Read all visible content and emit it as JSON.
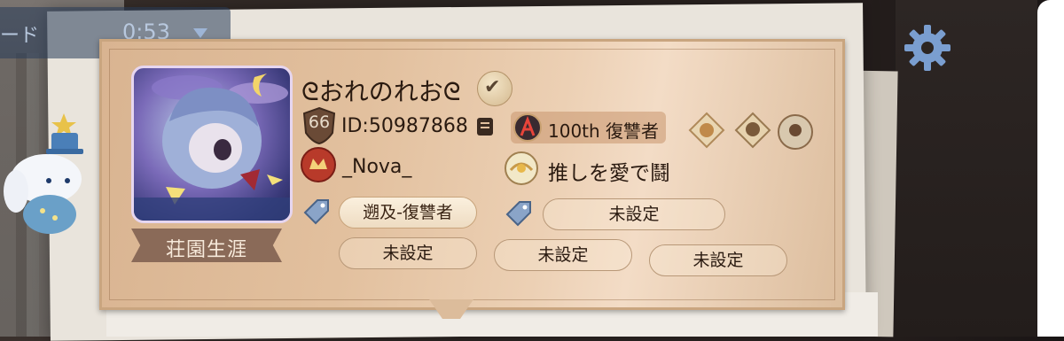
{
  "status_bar": {
    "mode_text": "ード",
    "timer": "0:53"
  },
  "profile": {
    "name": "ᘓおれのれおᘓ",
    "level": "66",
    "id": "ID:50987868",
    "rank": "100th 復讐者",
    "team": "_Nova_",
    "motto": "推しを愛で鬪",
    "career_label": "荘園生涯"
  },
  "tags": {
    "row1_left": "遡及-復讐者",
    "row1_right": "未設定",
    "row2": [
      "未設定",
      "未設定",
      "未設定"
    ]
  },
  "icons": {
    "settings": "gear-icon",
    "verify": "checkmark-icon",
    "level": "shield-level-icon",
    "id_card": "notebook-icon",
    "rank": "rank-emblem-icon",
    "badges": [
      "badge-diamond-1-icon",
      "badge-diamond-2-icon",
      "badge-circle-icon"
    ],
    "team": "team-emblem-icon",
    "motto": "motto-medal-icon",
    "tag": "tag-icon"
  },
  "colors": {
    "card": "#e2c09e",
    "card_border": "#c9a57f",
    "text": "#2a1a10",
    "status_text": "#b8c8de",
    "gear": "#7a9ed0"
  }
}
